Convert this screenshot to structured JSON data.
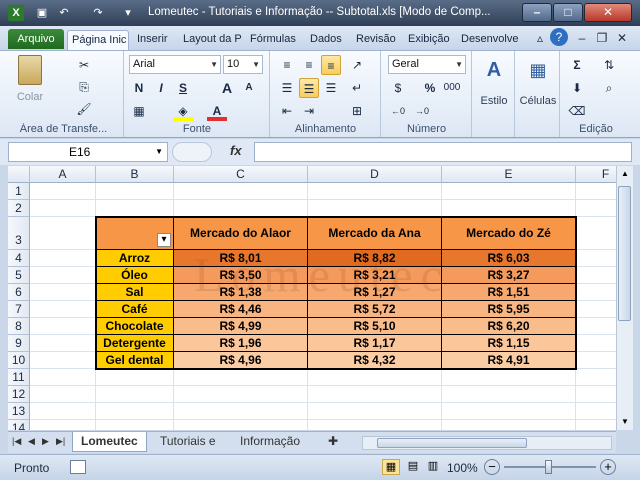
{
  "window": {
    "title": "Lomeutec - Tutoriais e Informação -- Subtotal.xls  [Modo de Comp...",
    "minimize": "–",
    "maximize": "□",
    "close": "✕"
  },
  "ribbon_tabs": [
    "Arquivo",
    "Página Inic",
    "Inserir",
    "Layout da P",
    "Fórmulas",
    "Dados",
    "Revisão",
    "Exibição",
    "Desenvolve"
  ],
  "groups": {
    "clipboard": {
      "label": "Área de Transfe...",
      "paste": "Colar"
    },
    "font": {
      "label": "Fonte",
      "name": "Arial",
      "size": "10",
      "bold": "N",
      "italic": "I",
      "underline": "S",
      "grow": "A",
      "shrink": "A"
    },
    "alignment": {
      "label": "Alinhamento"
    },
    "number": {
      "label": "Número",
      "format": "Geral",
      "percent": "%",
      "thousands": "000"
    },
    "styles": {
      "label": "Estilo"
    },
    "cells": {
      "label": "Células"
    },
    "editing": {
      "label": "Edição"
    }
  },
  "formula_bar": {
    "name_box": "E16",
    "fx": "fx",
    "content": ""
  },
  "columns": [
    "A",
    "B",
    "C",
    "D",
    "E",
    "F"
  ],
  "rows": [
    "1",
    "2",
    "3",
    "4",
    "5",
    "6",
    "7",
    "8",
    "9",
    "10",
    "11",
    "12",
    "13",
    "14"
  ],
  "table": {
    "headers": [
      "Mercado do Alaor",
      "Mercado da Ana",
      "Mercado do Zé"
    ],
    "products": [
      "Arroz",
      "Óleo",
      "Sal",
      "Café",
      "Chocolate",
      "Detergente",
      "Gel dental"
    ],
    "values": [
      [
        "R$ 8,01",
        "R$ 8,82",
        "R$ 6,03"
      ],
      [
        "R$ 3,50",
        "R$ 3,21",
        "R$ 3,27"
      ],
      [
        "R$ 1,38",
        "R$ 1,27",
        "R$ 1,51"
      ],
      [
        "R$ 4,46",
        "R$ 5,72",
        "R$ 5,95"
      ],
      [
        "R$ 4,99",
        "R$ 5,10",
        "R$ 6,20"
      ],
      [
        "R$ 1,96",
        "R$ 1,17",
        "R$ 1,15"
      ],
      [
        "R$ 4,96",
        "R$ 4,32",
        "R$ 4,91"
      ]
    ]
  },
  "watermark": "Lomeutec",
  "colors": {
    "header_orange": "#f79646",
    "product_yellow": "#ffcc00",
    "row_dark": "#e8772e",
    "row_light": "#fbc39a"
  },
  "sheet_tabs": [
    "Lomeutec",
    "Tutoriais e",
    "Informação"
  ],
  "status": {
    "ready": "Pronto",
    "zoom": "100%",
    "minus": "−",
    "plus": "+"
  }
}
